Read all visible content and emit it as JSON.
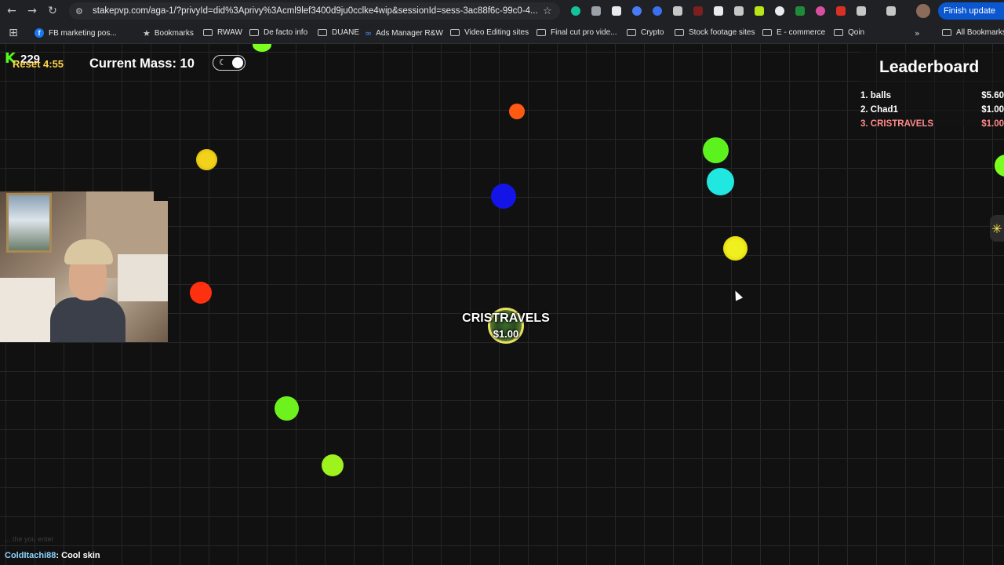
{
  "browser": {
    "url": "stakepvp.com/aga-1/?privyId=did%3Aprivy%3Acml9lef3400d9ju0cclke4wip&sessionId=sess-3ac88f6c-99c0-4...",
    "finish_update_label": "Finish update",
    "bookmarks": [
      {
        "label": "FB marketing pos...",
        "icon": "facebook-icon"
      },
      {
        "label": "Bookmarks",
        "icon": "star-icon"
      },
      {
        "label": "RWAW",
        "icon": "folder-icon"
      },
      {
        "label": "De facto info",
        "icon": "folder-icon"
      },
      {
        "label": "DUANE",
        "icon": "folder-icon"
      },
      {
        "label": "Ads Manager R&W",
        "icon": "meta-icon"
      },
      {
        "label": "Video Editing sites",
        "icon": "folder-icon"
      },
      {
        "label": "Final cut pro vide...",
        "icon": "folder-icon"
      },
      {
        "label": "Crypto",
        "icon": "folder-icon"
      },
      {
        "label": "Stock footage sites",
        "icon": "folder-icon"
      },
      {
        "label": "E - commerce",
        "icon": "folder-icon"
      },
      {
        "label": "Qoin",
        "icon": "folder-icon"
      }
    ],
    "all_bookmarks_label": "All Bookmarks"
  },
  "hud": {
    "score": "229",
    "reset": "Reset 4:55",
    "mass": "Current Mass: 10",
    "dark_mode": true
  },
  "leaderboard": {
    "title": "Leaderboard",
    "rows": [
      {
        "name": "1. balls",
        "amount": "$5.60"
      },
      {
        "name": "2. Chad1",
        "amount": "$1.00"
      },
      {
        "name": "3. CRISTRAVELS",
        "amount": "$1.00"
      }
    ]
  },
  "player": {
    "name": "CRISTRAVELS",
    "money": "$1.00"
  },
  "chat": {
    "faded": "... the you enter",
    "user": "ColdItachi88",
    "message": ": Cool skin"
  },
  "colors": {
    "accent_green": "#53fc18",
    "reset_yellow": "#ffd54a",
    "self_highlight": "#ff8a8a",
    "pellets": [
      "#7bff1e",
      "#ff5a12",
      "#f2d21a",
      "#1414e6",
      "#20e8e0",
      "#f0f020",
      "#ff3010"
    ]
  }
}
